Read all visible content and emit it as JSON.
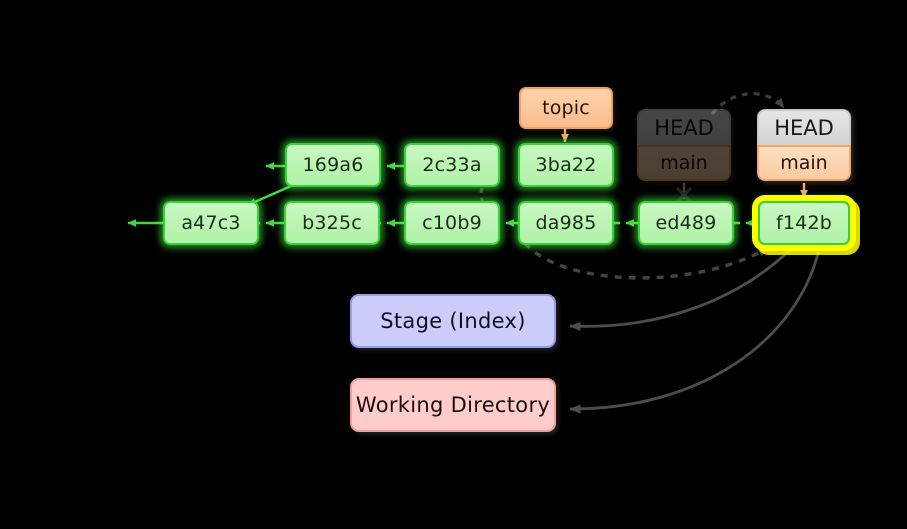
{
  "diagram": {
    "title": "git repository state diagram",
    "background_color": "#000000",
    "colors": {
      "commit_fill": "#bdf5b5",
      "commit_border": "#35d435",
      "commit_glow": "#46ff46",
      "branch_fill": "#fcc79b",
      "branch_border": "#f0a060",
      "head_fill": "#dcdcdc",
      "head_border": "#c9c9c9",
      "highlight": "#ffff00",
      "stage_fill": "#ccccfa",
      "stage_border": "#9a9aee",
      "workdir_fill": "#ffcccc",
      "workdir_border": "#f79b9b",
      "arrow_gray": "#4d4d4d",
      "arrow_green": "#35d435",
      "arrow_orange": "#f0a060"
    }
  },
  "commits": {
    "top_row": [
      {
        "id": "169a6",
        "label": "169a6"
      },
      {
        "id": "2c33a",
        "label": "2c33a"
      },
      {
        "id": "3ba22",
        "label": "3ba22"
      }
    ],
    "bottom_row": [
      {
        "id": "a47c3",
        "label": "a47c3"
      },
      {
        "id": "b325c",
        "label": "b325c"
      },
      {
        "id": "c10b9",
        "label": "c10b9"
      },
      {
        "id": "da985",
        "label": "da985"
      },
      {
        "id": "ed489",
        "label": "ed489"
      },
      {
        "id": "f142b",
        "label": "f142b",
        "highlighted": true
      }
    ]
  },
  "labels": {
    "topic_branch": "topic"
  },
  "head_boxes": {
    "previous": {
      "head": "HEAD",
      "branch": "main",
      "state": "faded"
    },
    "current": {
      "head": "HEAD",
      "branch": "main",
      "state": "active"
    }
  },
  "areas": {
    "stage": "Stage (Index)",
    "working_directory": "Working Directory"
  }
}
